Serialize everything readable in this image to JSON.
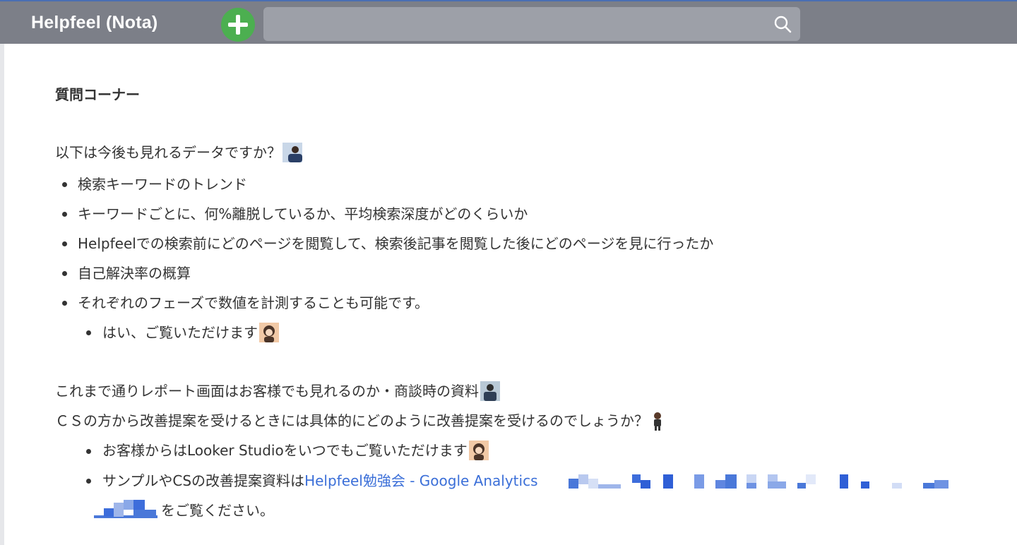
{
  "header": {
    "brand": "Helpfeel (Nota)",
    "search": {
      "value": "",
      "placeholder": ""
    }
  },
  "page": {
    "heading": "質問コーナー",
    "q1": "以下は今後も見れるデータですか？",
    "q1_items": [
      "検索キーワードのトレンド",
      "キーワードごとに、何%離脱しているか、平均検索深度がどのくらいか",
      "Helpfeelでの検索前にどのページを閲覧して、検索後記事を閲覧した後にどのページを見に行ったか",
      "自己解決率の概算",
      "それぞれのフェーズで数値を計測することも可能です。"
    ],
    "q1_answer": "はい、ご覧いただけます",
    "q2": "これまで通りレポート画面はお客様でも見れるのか・商談時の資料",
    "q3": "ＣＳの方から改善提案を受けるときには具体的にどのように改善提案を受けるのでしょうか？",
    "q3_answer_1": "お客様からはLooker Studioをいつでもご覧いただけます",
    "q3_answer_2_prefix": "サンプルやCSの改善提案資料は",
    "q3_answer_2_link": "Helpfeel勉強会 - Google Analytics",
    "q3_answer_2_suffix": "をご覧ください。"
  },
  "colors": {
    "topbar": "#7c7f88",
    "add_button": "#4caf50",
    "link": "#3b6fd8",
    "text": "#333333"
  },
  "icons": [
    "plus-icon",
    "search-icon",
    "user-icon"
  ]
}
